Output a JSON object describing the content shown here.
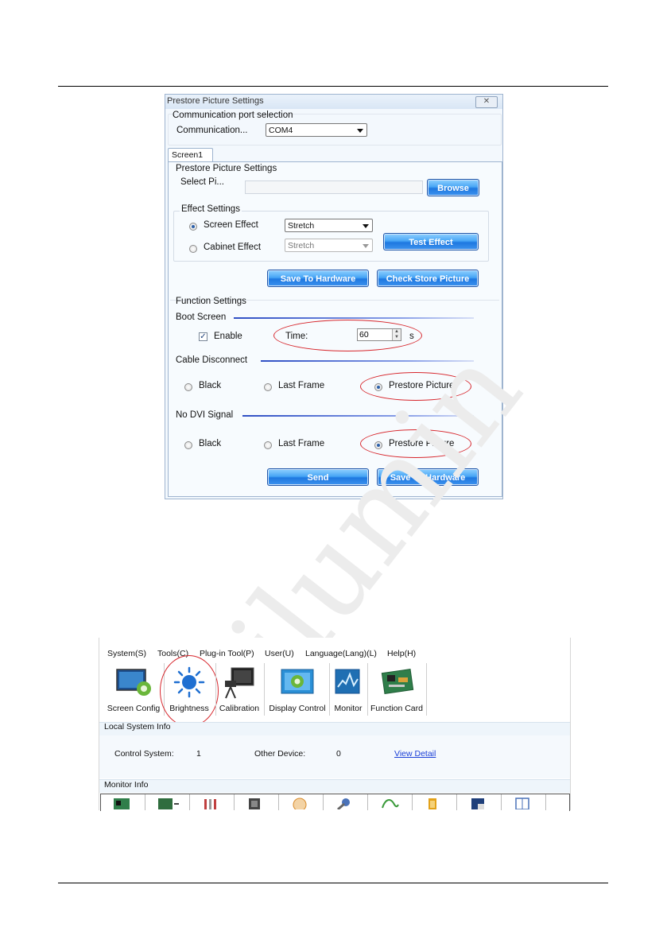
{
  "dialog": {
    "title": "Prestore Picture Settings",
    "close_glyph": "✕",
    "comm_group_label": "Communication port selection",
    "comm_label": "Communication...",
    "comm_value": "COM4",
    "tab": "Screen1",
    "prestore_group": "Prestore Picture Settings",
    "select_label": "Select Pi...",
    "browse": "Browse",
    "effect_group": "Effect Settings",
    "screen_effect": "Screen Effect",
    "screen_effect_value": "Stretch",
    "cabinet_effect": "Cabinet Effect",
    "cabinet_effect_value": "Stretch",
    "test_effect": "Test Effect",
    "save_to_hardware": "Save To Hardware",
    "check_store_picture": "Check Store Picture",
    "function_group": "Function Settings",
    "boot_screen": "Boot Screen",
    "enable": "Enable",
    "enable_checked": true,
    "time_label": "Time:",
    "time_value": "60",
    "time_unit": "s",
    "cable_disconnect": "Cable Disconnect",
    "no_dvi_signal": "No DVI Signal",
    "black": "Black",
    "last_frame": "Last Frame",
    "prestore_picture": "Prestore Picture",
    "send": "Send",
    "save_to_hardware_2": "Save To Hardware"
  },
  "main_window": {
    "menu": [
      "System(S)",
      "Tools(C)",
      "Plug-in Tool(P)",
      "User(U)",
      "Language(Lang)(L)",
      "Help(H)"
    ],
    "toolbar": [
      "Screen Config",
      "Brightness",
      "Calibration",
      "Display Control",
      "Monitor",
      "Function Card"
    ],
    "local_system_info": "Local System Info",
    "control_system_label": "Control System:",
    "control_system_value": "1",
    "other_device_label": "Other Device:",
    "other_device_value": "0",
    "view_detail": "View Detail",
    "monitor_info": "Monitor Info"
  },
  "colors": {
    "button_blue": "#2f86e8",
    "highlight_red": "#d7262c",
    "separator_blue": "#2f4fc4",
    "link_blue": "#1a3fd6"
  }
}
